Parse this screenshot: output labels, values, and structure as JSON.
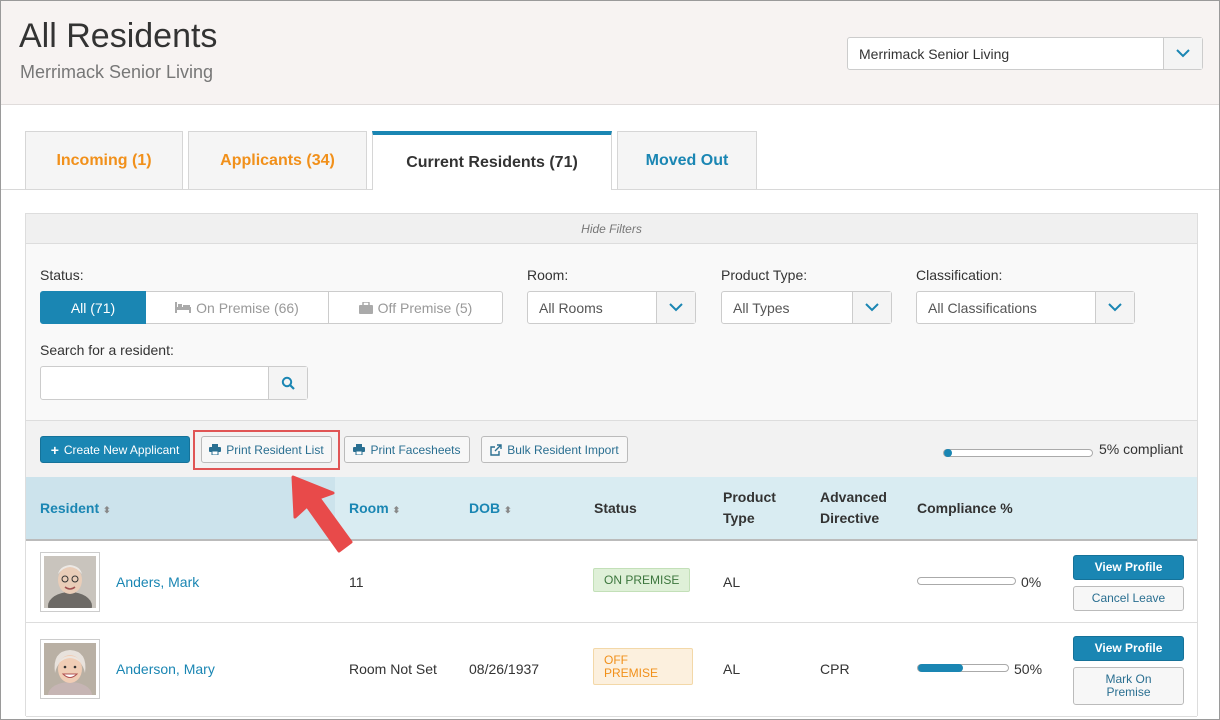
{
  "header": {
    "title": "All Residents",
    "subtitle": "Merrimack Senior Living",
    "community_select": "Merrimack Senior Living"
  },
  "tabs": [
    {
      "label": "Incoming  (1)"
    },
    {
      "label": "Applicants  (34)"
    },
    {
      "label": "Current Residents  (71)"
    },
    {
      "label": "Moved Out"
    }
  ],
  "filters": {
    "hide_label": "Hide Filters",
    "status_label": "Status:",
    "status_options": [
      "All (71)",
      "On Premise (66)",
      "Off Premise (5)"
    ],
    "room_label": "Room:",
    "room_value": "All Rooms",
    "product_label": "Product Type:",
    "product_value": "All Types",
    "class_label": "Classification:",
    "class_value": "All Classifications",
    "search_label": "Search for a resident:",
    "search_value": ""
  },
  "toolbar": {
    "create": "Create New Applicant",
    "print_list": "Print Resident List",
    "print_facesheets": "Print Facesheets",
    "bulk_import": "Bulk Resident Import",
    "compliance_fraction": 0.05,
    "compliance_text": "5% compliant"
  },
  "table": {
    "headers": {
      "resident": "Resident",
      "room": "Room",
      "dob": "DOB",
      "status": "Status",
      "product_1": "Product",
      "product_2": "Type",
      "advanced_1": "Advanced",
      "advanced_2": "Directive",
      "compliance": "Compliance %"
    },
    "rows": [
      {
        "name": "Anders, Mark",
        "room": "11",
        "dob": "",
        "status": "ON PREMISE",
        "product": "AL",
        "directive": "",
        "compliance_fraction": 0.0,
        "compliance_text": "0%",
        "btn1": "View Profile",
        "btn2": "Cancel Leave"
      },
      {
        "name": "Anderson, Mary",
        "room": "Room Not Set",
        "dob": "08/26/1937",
        "status": "OFF PREMISE",
        "product": "AL",
        "directive": "CPR",
        "compliance_fraction": 0.5,
        "compliance_text": "50%",
        "btn1": "View Profile",
        "btn2": "Mark On Premise"
      }
    ]
  },
  "colors": {
    "accent": "#1a86b3",
    "orange": "#f1901a",
    "highlight": "#e05555"
  }
}
